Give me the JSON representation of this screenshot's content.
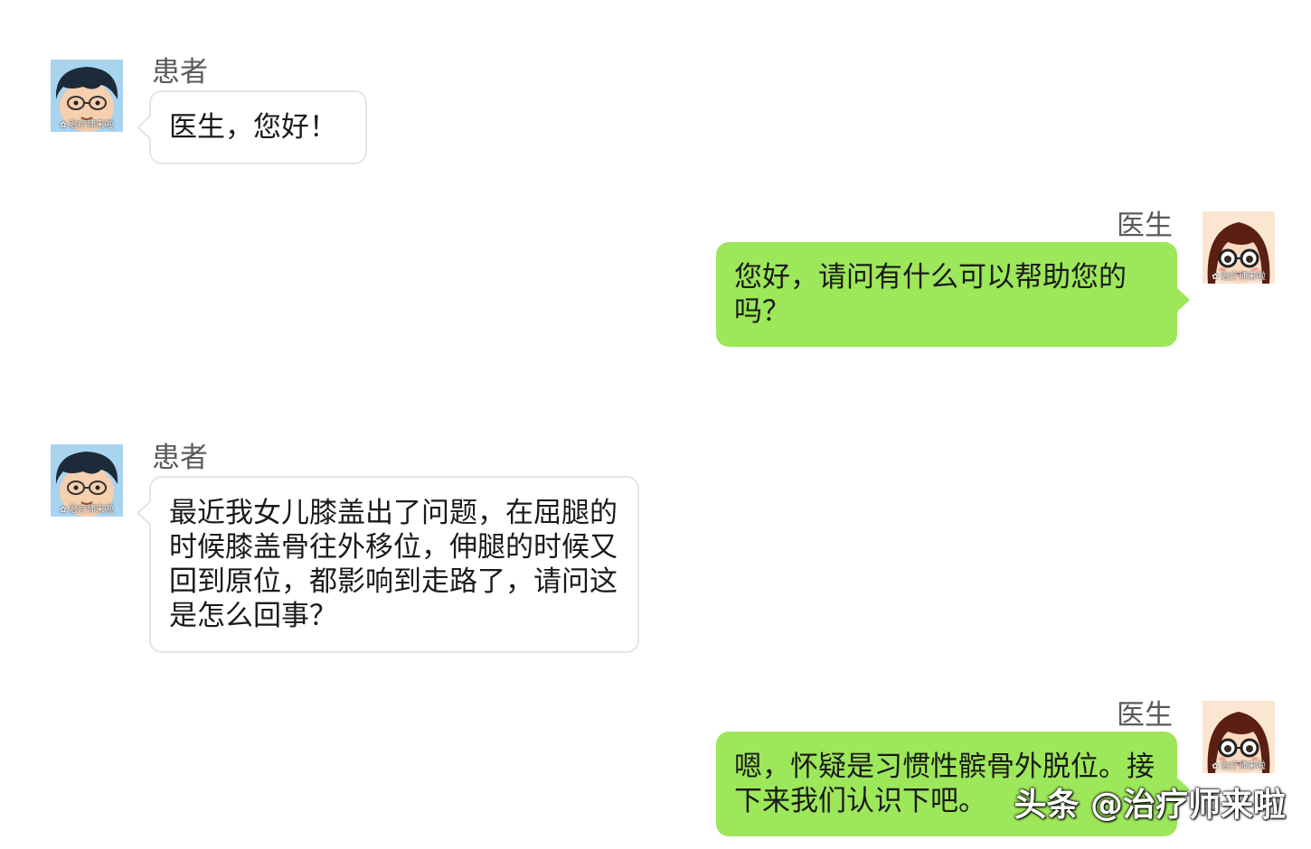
{
  "messages": [
    {
      "side": "left",
      "sender": "患者",
      "text": "医生，您好！",
      "avatar_icon": "patient-boy-avatar"
    },
    {
      "side": "right",
      "sender": "医生",
      "text": "您好，请问有什么可以帮助您的吗？",
      "avatar_icon": "doctor-girl-avatar"
    },
    {
      "side": "left",
      "sender": "患者",
      "text": "最近我女儿膝盖出了问题，在屈腿的时候膝盖骨往外移位，伸腿的时候又回到原位，都影响到走路了，请问这是怎么回事？",
      "avatar_icon": "patient-boy-avatar"
    },
    {
      "side": "right",
      "sender": "医生",
      "text": "嗯，怀疑是习惯性髌骨外脱位。接下来我们认识下吧。",
      "avatar_icon": "doctor-girl-avatar"
    }
  ],
  "avatar_watermark": "治疗师来啦",
  "watermark": "头条 @治疗师来啦",
  "colors": {
    "right_bubble": "#9de75a",
    "left_bubble": "#ffffff",
    "left_bubble_border": "#e6e6e6",
    "sender_text": "#5a5a5a"
  }
}
